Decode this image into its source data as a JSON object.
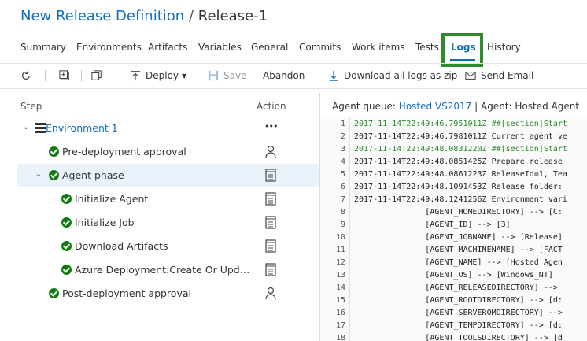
{
  "header": {
    "definition_link": "New Release Definition",
    "separator": "/",
    "release_name": "Release-1"
  },
  "tabs": [
    {
      "label": "Summary"
    },
    {
      "label": "Environments"
    },
    {
      "label": "Artifacts"
    },
    {
      "label": "Variables"
    },
    {
      "label": "General"
    },
    {
      "label": "Commits"
    },
    {
      "label": "Work items"
    },
    {
      "label": "Tests"
    },
    {
      "label": "Logs",
      "active": true
    },
    {
      "label": "History"
    }
  ],
  "toolbar": {
    "deploy_label": "Deploy",
    "save_label": "Save",
    "abandon_label": "Abandon",
    "download_label": "Download all logs as zip",
    "email_label": "Send Email"
  },
  "tree": {
    "step_header": "Step",
    "action_header": "Action",
    "environment": "Environment 1",
    "environment_action": "•••",
    "items": [
      {
        "label": "Pre-deployment approval",
        "action_icon": "person-icon"
      },
      {
        "label": "Agent phase",
        "action_icon": "log-icon"
      },
      {
        "label": "Initialize Agent",
        "action_icon": "log-icon"
      },
      {
        "label": "Initialize Job",
        "action_icon": "log-icon"
      },
      {
        "label": "Download Artifacts",
        "action_icon": "log-icon"
      },
      {
        "label": "Azure Deployment:Create Or Update ...",
        "action_icon": "log-icon"
      },
      {
        "label": "Post-deployment approval",
        "action_icon": "person-icon"
      }
    ]
  },
  "log": {
    "queue_prefix": "Agent queue: ",
    "queue_link": "Hosted VS2017",
    "queue_suffix": " | Agent: Hosted Agent",
    "lines": [
      {
        "n": "1",
        "text": "2017-11-14T22:49:46.7951011Z ##[section]Start",
        "green": true
      },
      {
        "n": "2",
        "text": "2017-11-14T22:49:46.7981011Z Current agent ve",
        "green": false
      },
      {
        "n": "3",
        "text": "2017-11-14T22:49:48.0831220Z ##[section]Start",
        "green": true
      },
      {
        "n": "4",
        "text": "2017-11-14T22:49:48.0851425Z Prepare release",
        "green": false
      },
      {
        "n": "5",
        "text": "2017-11-14T22:49:48.0861223Z ReleaseId=1, Tea",
        "green": false
      },
      {
        "n": "6",
        "text": "2017-11-14T22:49:48.1091453Z Release folder:",
        "green": false
      },
      {
        "n": "7",
        "text": "2017-11-14T22:49:48.1241256Z Environment vari",
        "green": false
      },
      {
        "n": "8",
        "text": "               [AGENT_HOMEDIRECTORY] --> [C:",
        "green": false
      },
      {
        "n": "9",
        "text": "               [AGENT_ID] --> [3]",
        "green": false
      },
      {
        "n": "10",
        "text": "               [AGENT_JOBNAME] --> [Release]",
        "green": false
      },
      {
        "n": "11",
        "text": "               [AGENT_MACHINENAME] --> [FACT",
        "green": false
      },
      {
        "n": "12",
        "text": "               [AGENT_NAME] --> [Hosted Agen",
        "green": false
      },
      {
        "n": "13",
        "text": "               [AGENT_OS] --> [Windows_NT]",
        "green": false
      },
      {
        "n": "14",
        "text": "               [AGENT_RELEASEDIRECTORY] -->",
        "green": false
      },
      {
        "n": "15",
        "text": "               [AGENT_ROOTDIRECTORY] --> [d:",
        "green": false
      },
      {
        "n": "16",
        "text": "               [AGENT_SERVEROMDIRECTORY] -->",
        "green": false
      },
      {
        "n": "17",
        "text": "               [AGENT_TEMPDIRECTORY] --> [d:",
        "green": false
      },
      {
        "n": "18",
        "text": "               [AGENT_TOOLSDIRECTORY] --> [d",
        "green": false
      }
    ]
  },
  "colors": {
    "accent": "#106ebe",
    "success": "#107c10",
    "highlight_box": "#2e8b2e",
    "log_green": "#2b8a2b"
  }
}
